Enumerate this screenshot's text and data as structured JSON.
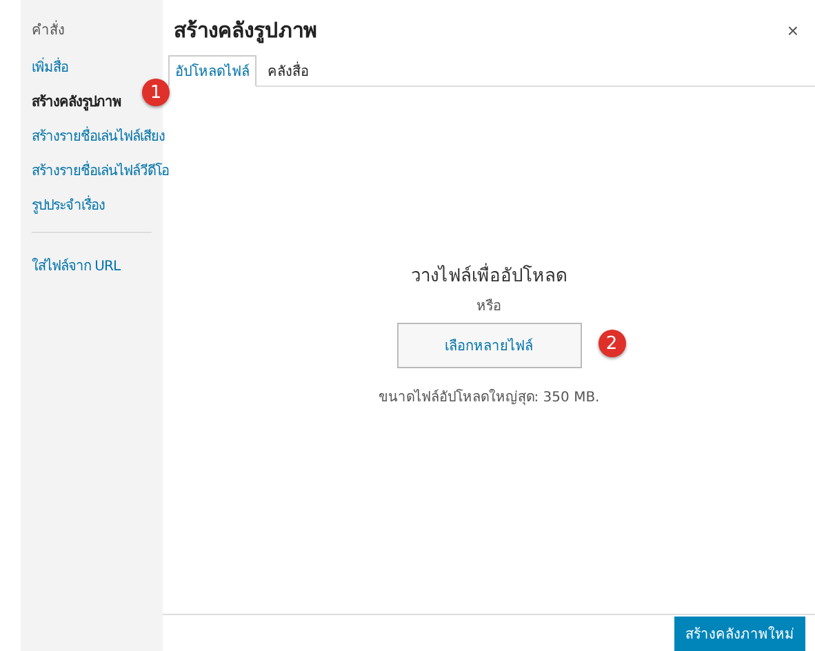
{
  "sidebar": {
    "heading": "คำสั่ง",
    "items": [
      {
        "label": "เพิ่มสื่อ",
        "selected": false
      },
      {
        "label": "สร้างคลังรูปภาพ",
        "selected": true,
        "badge": "1"
      },
      {
        "label": "สร้างรายชื่อเล่นไฟล์เสียง",
        "selected": false
      },
      {
        "label": "สร้างรายชื่อเล่นไฟล์วีดีโอ",
        "selected": false
      },
      {
        "label": "รูปประจำเรื่อง",
        "selected": false
      }
    ],
    "extra_items": [
      {
        "label": "ใส่ไฟล์จาก URL",
        "selected": false
      }
    ]
  },
  "title": "สร้างคลังรูปภาพ",
  "close": "×",
  "tabs": [
    {
      "label": "อัปโหลดไฟล์",
      "selected": true
    },
    {
      "label": "คลังสื่อ",
      "selected": false
    }
  ],
  "upload": {
    "instructions": "วางไฟล์เพื่ออัปโหลด",
    "or": "หรือ",
    "button": "เลือกหลายไฟล์",
    "badge": "2",
    "max_size": "ขนาดไฟล์อัปโหลดใหญ่สุด: 350 MB."
  },
  "footer": {
    "button": "สร้างคลังภาพใหม่"
  }
}
